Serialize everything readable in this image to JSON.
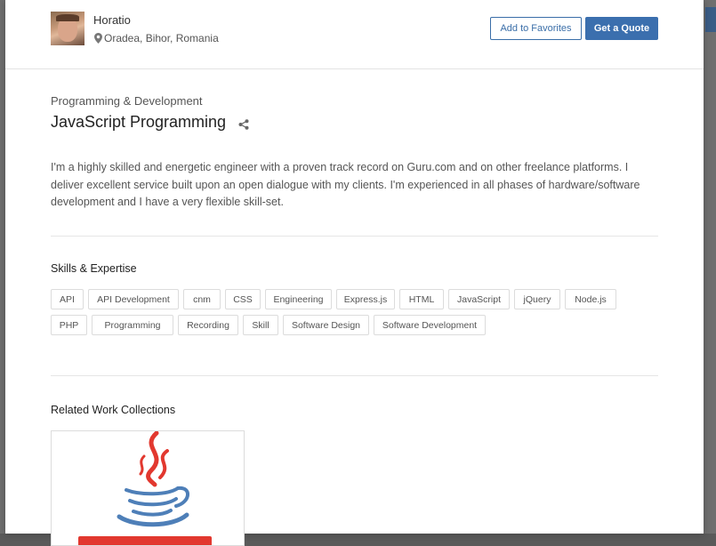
{
  "header": {
    "name": "Horatio",
    "location": "Oradea, Bihor, Romania",
    "favorite_label": "Add to Favorites",
    "quote_label": "Get a Quote"
  },
  "service": {
    "category": "Programming & Development",
    "title": "JavaScript Programming",
    "description": "I'm a highly skilled and energetic engineer with a proven track record on Guru.com and on other freelance platforms. I deliver excellent service built upon an open dialogue with my clients. I'm experienced in all phases of hardware/software development and I have a very flexible skill-set."
  },
  "skills": {
    "title": "Skills & Expertise",
    "items": [
      "API",
      "API Development",
      "cnm",
      "CSS",
      "Engineering",
      "Express.js",
      "HTML",
      "JavaScript",
      "jQuery",
      "Node.js",
      "PHP",
      "Programming",
      "Recording",
      "Skill",
      "Software Design",
      "Software Development"
    ]
  },
  "collections": {
    "title": "Related Work Collections"
  },
  "colors": {
    "accent": "#3b6fae",
    "java_red": "#e2382f",
    "java_blue": "#4e7fb8"
  },
  "icons": {
    "location": "map-pin-icon",
    "share": "share-icon"
  }
}
